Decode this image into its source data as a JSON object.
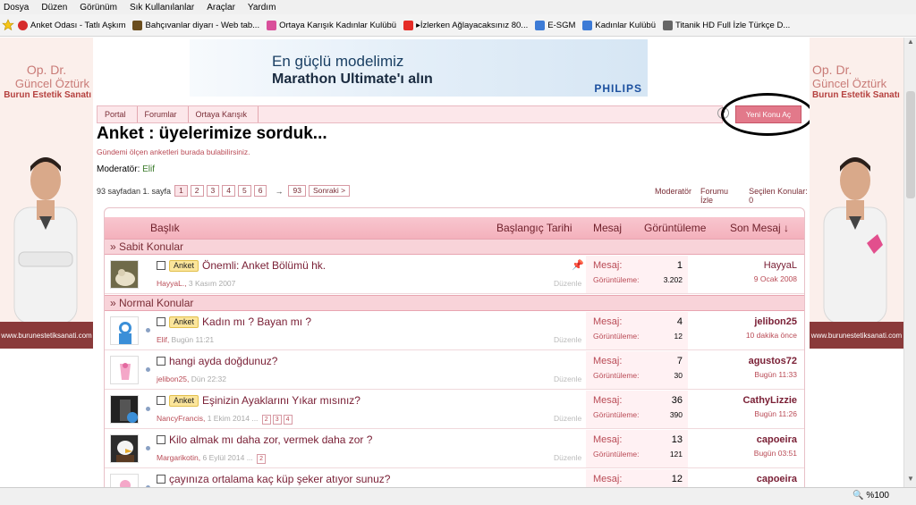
{
  "browser": {
    "menu": [
      "Dosya",
      "Düzen",
      "Görünüm",
      "Sık Kullanılanlar",
      "Araçlar",
      "Yardım"
    ],
    "favorites": [
      {
        "label": "Anket Odası - Tatlı Aşkım",
        "color": "#d62b2b"
      },
      {
        "label": "Bahçıvanlar diyarı - Web tab...",
        "color": "#6b4e1e"
      },
      {
        "label": "Ortaya Karışık Kadınlar Kulübü",
        "color": "#d94f9a"
      },
      {
        "label": "▸İzlerken Ağlayacaksınız 80...",
        "color": "#e52d27"
      },
      {
        "label": "E-SGM",
        "color": "#3d7bd6"
      },
      {
        "label": "Kadınlar Kulübü",
        "color": "#3d7bd6"
      },
      {
        "label": "Titanik HD Full İzle Türkçe D...",
        "color": "#666666"
      }
    ],
    "zoom": "%100"
  },
  "ad": {
    "line1": "Op. Dr.",
    "line2": "Güncel Öztürk",
    "line3": "Burun Estetik Sanatı",
    "url": "www.burunestetiksanati.com"
  },
  "banner": {
    "line1": "En güçlü modelimiz",
    "line2": "Marathon Ultimate'ı alın",
    "brand": "PHILIPS"
  },
  "breadcrumb": [
    "Portal",
    "Forumlar",
    "Ortaya Karışık"
  ],
  "new_topic_label": "Yeni Konu Aç",
  "help_label": "?",
  "forum": {
    "title": "Anket : üyelerimize sorduk...",
    "description": "Gündemi ölçen anketleri burada bulabilirsiniz.",
    "moderator_label": "Moderatör:",
    "moderator_name": "Elif"
  },
  "pager": {
    "info": "93 sayfadan 1. sayfa",
    "pages": [
      "1",
      "2",
      "3",
      "4",
      "5",
      "6"
    ],
    "arrow": "→",
    "last": "93",
    "next": "Sonraki >"
  },
  "right_links": [
    "Moderatör",
    "Forumu İzle",
    "Seçilen Konular: 0"
  ],
  "columns": {
    "title": "Başlık",
    "start_date": "Başlangıç Tarihi",
    "posts": "Mesaj",
    "views": "Görüntüleme",
    "last_post": "Son Mesaj ↓"
  },
  "sections": {
    "sticky": "» Sabit Konular",
    "normal": "» Normal Konular"
  },
  "labels": {
    "posts": "Mesaj:",
    "views": "Görüntüleme:",
    "edit": "Düzenle"
  },
  "sticky_topics": [
    {
      "tag": "Anket",
      "title": "Önemli: Anket Bölümü hk.",
      "author": "HayyaL.",
      "date": "3 Kasım 2007",
      "posts": "1",
      "views": "3.202",
      "last_user": "HayyaL",
      "last_time": "9 Ocak 2008"
    }
  ],
  "topics": [
    {
      "tag": "Anket",
      "title": "Kadın mı ? Bayan mı ?",
      "author": "Elif",
      "date": "Bugün 11:21",
      "pages": [],
      "posts": "4",
      "views": "12",
      "last_user": "jelibon25",
      "last_time": "10 dakika önce"
    },
    {
      "tag": "",
      "title": "hangi ayda doğdunuz?",
      "author": "jelibon25",
      "date": "Dün 22:32",
      "pages": [],
      "posts": "7",
      "views": "30",
      "last_user": "agustos72",
      "last_time": "Bugün 11:33"
    },
    {
      "tag": "Anket",
      "title": "Eşinizin Ayaklarını Yıkar mısınız?",
      "author": "NancyFrancis",
      "date": "1 Ekim 2014",
      "pages": [
        "2",
        "3",
        "4"
      ],
      "posts": "36",
      "views": "390",
      "last_user": "CathyLizzie",
      "last_time": "Bugün 11:26"
    },
    {
      "tag": "",
      "title": "Kilo almak mı daha zor, vermek daha zor ?",
      "author": "Margarikotin",
      "date": "6 Eylül 2014",
      "pages": [
        "2"
      ],
      "posts": "13",
      "views": "121",
      "last_user": "capoeira",
      "last_time": "Bugün 03:51"
    },
    {
      "tag": "",
      "title": "çayınıza ortalama kaç küp şeker atıyor sunuz?",
      "author": "",
      "date": "",
      "pages": [],
      "posts": "12",
      "views": "",
      "last_user": "capoeira",
      "last_time": ""
    }
  ]
}
